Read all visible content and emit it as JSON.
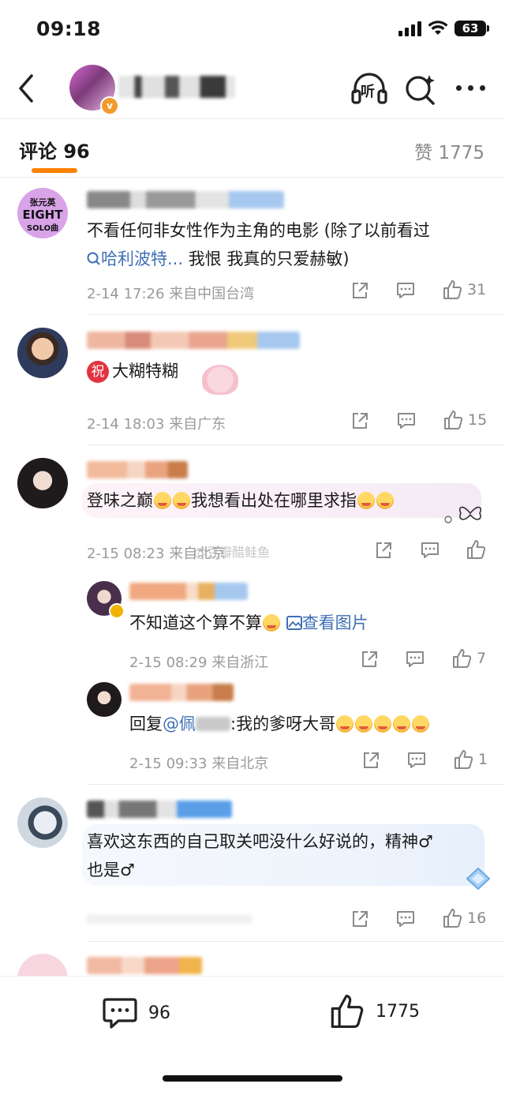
{
  "status_bar": {
    "time": "09:18",
    "battery": "63"
  },
  "header": {
    "back_icon": "chevron-left-icon",
    "listen_label": "听"
  },
  "tabs": {
    "comments_label": "评论 96",
    "likes_label": "赞 1775"
  },
  "comments": [
    {
      "avatar_text": [
        "张元英",
        "EIGHT",
        "SOLO曲"
      ],
      "text_line1": "不看任何非女性作为主角的电影 (除了以前看过",
      "text_line2_link": "哈利波特...",
      "text_line2_rest": " 我恨 我真的只爱赫敏)",
      "time": "2-14 17:26",
      "location": "来自中国台湾",
      "likes": "31"
    },
    {
      "badge": "祝",
      "text": "大糊特糊",
      "time": "2-14 18:03",
      "location": "来自广东",
      "likes": "15"
    },
    {
      "text": "登味之巅",
      "text_tail": "我想看出处在哪里求指",
      "time": "2-15 08:23",
      "location": "来自北京",
      "watermark": "@豆瓣醋鲑鱼",
      "replies": [
        {
          "text": "不知道这个算不算",
          "link": "查看图片",
          "time": "2-15 08:29",
          "location": "来自浙江",
          "likes": "7"
        },
        {
          "prefix": "回复",
          "mention": "@佩",
          "text": ":我的爹呀大哥",
          "time": "2-15 09:33",
          "location": "来自北京",
          "likes": "1"
        }
      ]
    },
    {
      "text_line1": "喜欢这东西的自己取关吧没什么好说的，精神♂",
      "text_line2": "也是♂",
      "likes": "16"
    }
  ],
  "bottom_bar": {
    "comments_count": "96",
    "likes_count": "1775"
  },
  "colors": {
    "accent": "#ff8200",
    "link": "#3f6fb5",
    "meta": "#9a9a9a"
  }
}
